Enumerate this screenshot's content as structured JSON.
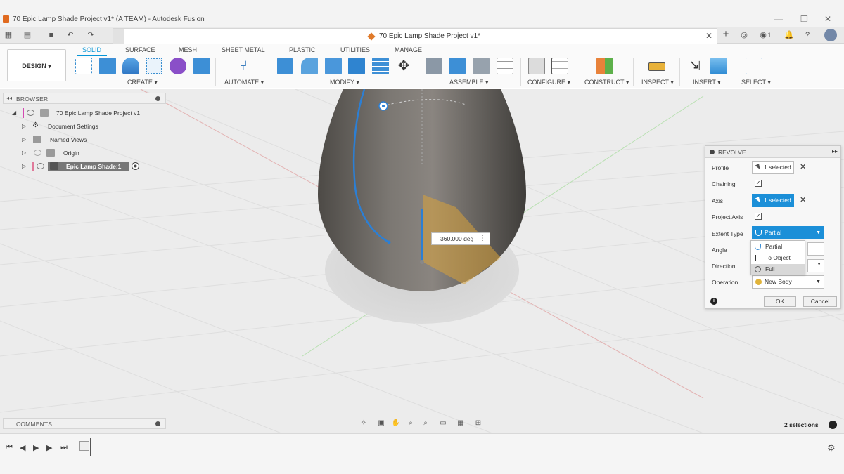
{
  "window": {
    "title": "70 Epic Lamp Shade Project v1* (A TEAM) - Autodesk Fusion",
    "minimize": "—",
    "maximize": "❐",
    "close": "✕"
  },
  "document_tab": {
    "name": "70 Epic Lamp Shade Project v1*",
    "close": "✕"
  },
  "top_right": {
    "notifications_count": "1"
  },
  "workspace": {
    "design_label": "DESIGN ▾"
  },
  "toolbar": {
    "tabs": [
      {
        "label": "SOLID"
      },
      {
        "label": "SURFACE"
      },
      {
        "label": "MESH"
      },
      {
        "label": "SHEET METAL"
      },
      {
        "label": "PLASTIC"
      },
      {
        "label": "UTILITIES"
      },
      {
        "label": "MANAGE"
      }
    ],
    "groups": [
      {
        "label": "CREATE ▾"
      },
      {
        "label": "AUTOMATE ▾"
      },
      {
        "label": "MODIFY ▾"
      },
      {
        "label": "ASSEMBLE ▾"
      },
      {
        "label": "CONFIGURE ▾"
      },
      {
        "label": "CONSTRUCT ▾"
      },
      {
        "label": "INSPECT ▾"
      },
      {
        "label": "INSERT ▾"
      },
      {
        "label": "SELECT ▾"
      }
    ]
  },
  "browser": {
    "title": "BROWSER",
    "items": [
      {
        "label": "70 Epic Lamp Shade Project v1"
      },
      {
        "label": "Document Settings"
      },
      {
        "label": "Named Views"
      },
      {
        "label": "Origin"
      },
      {
        "label": "Epic Lamp Shade:1"
      }
    ]
  },
  "comments": {
    "title": "COMMENTS"
  },
  "viewport": {
    "angle_value": "360.000 deg"
  },
  "revolve": {
    "title": "REVOLVE",
    "rows": {
      "profile": {
        "label": "Profile",
        "value": "1 selected"
      },
      "chaining": {
        "label": "Chaining",
        "checked": true
      },
      "axis": {
        "label": "Axis",
        "value": "1 selected"
      },
      "project_axis": {
        "label": "Project Axis",
        "checked": true
      },
      "extent_type": {
        "label": "Extent Type",
        "value": "Partial"
      },
      "angle": {
        "label": "Angle"
      },
      "direction": {
        "label": "Direction"
      },
      "operation": {
        "label": "Operation",
        "value": "New Body"
      }
    },
    "extent_options": [
      {
        "label": "Partial"
      },
      {
        "label": "To Object"
      },
      {
        "label": "Full"
      }
    ],
    "ok": "OK",
    "cancel": "Cancel",
    "check_mark": "✓",
    "clear": "✕"
  },
  "status": {
    "selections": "2 selections"
  },
  "colors": {
    "accent": "#0696d7",
    "selection_blue": "#1b8fd8",
    "model_gray": "#6f6b66",
    "component_marker": "#d44ab2"
  }
}
